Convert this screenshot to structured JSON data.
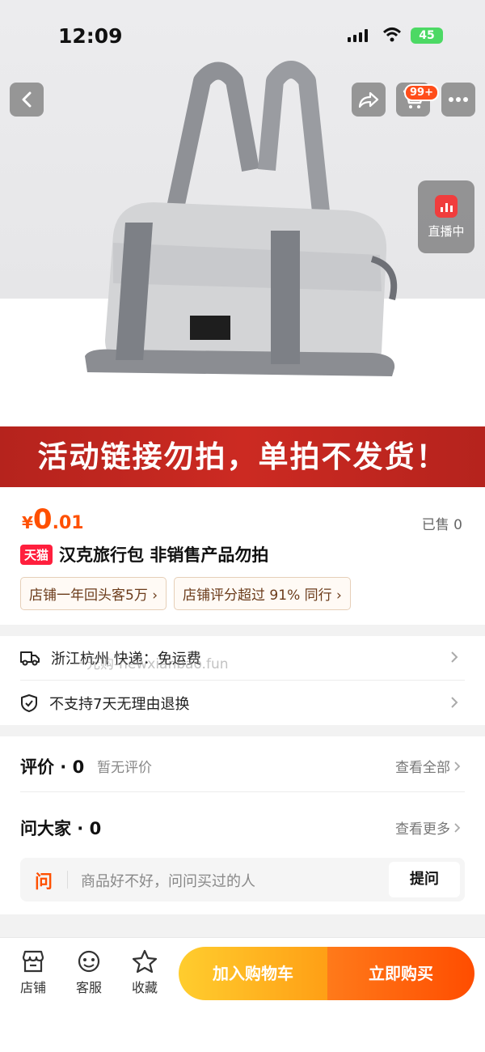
{
  "status_bar": {
    "time": "12:09",
    "battery": "45"
  },
  "nav": {
    "cart_badge": "99+",
    "live_label": "直播中"
  },
  "banner": {
    "text": "活动链接勿拍，单拍不发货！"
  },
  "price": {
    "currency": "¥",
    "integer": "0",
    "decimal": ".01",
    "sold": "已售 0"
  },
  "product": {
    "badge": "天猫",
    "title": "汉克旅行包 非销售产品勿拍"
  },
  "tags": [
    "店铺一年回头客5万",
    "店铺评分超过 91% 同行"
  ],
  "shipping": {
    "location_delivery": "浙江杭州  快递：免运费",
    "return_policy": "不支持7天无理由退换",
    "watermark": "一元购-newxianbao.fun"
  },
  "reviews": {
    "title": "评价 · 0",
    "subtitle": "暂无评价",
    "view_all": "查看全部"
  },
  "qa": {
    "title": "问大家 · 0",
    "view_more": "查看更多",
    "icon_char": "问",
    "placeholder": "商品好不好，问问买过的人",
    "ask_button": "提问"
  },
  "bottom_bar": {
    "store": "店铺",
    "service": "客服",
    "favorite": "收藏",
    "add_to_cart": "加入购物车",
    "buy_now": "立即购买"
  },
  "colors": {
    "accent": "#ff5000",
    "banner_red": "#cc2a22",
    "tmall_red": "#ff1f3d"
  }
}
